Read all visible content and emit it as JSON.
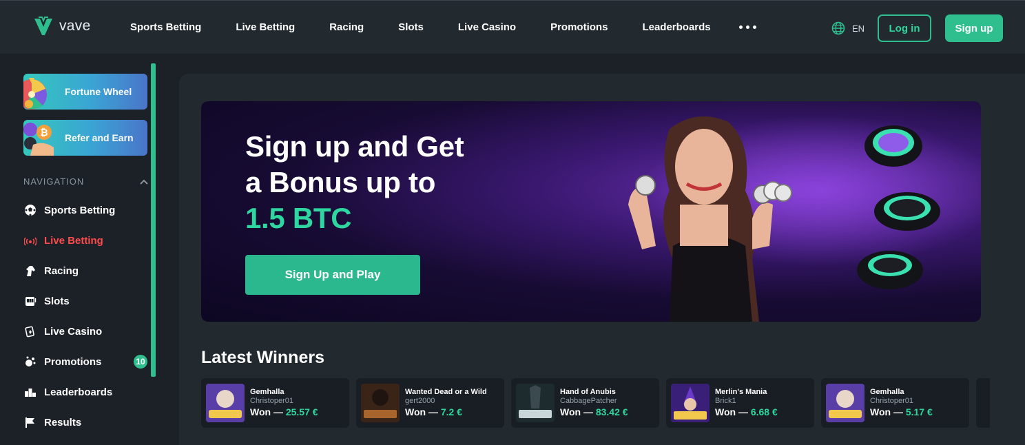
{
  "brand": {
    "name": "vave",
    "accent": "#2fbf8f"
  },
  "topnav": {
    "items": [
      "Sports Betting",
      "Live Betting",
      "Racing",
      "Slots",
      "Live Casino",
      "Promotions",
      "Leaderboards"
    ],
    "language": "EN",
    "login_label": "Log in",
    "signup_label": "Sign up"
  },
  "sidebar": {
    "promos": [
      {
        "label": "Fortune Wheel",
        "icon": "fortune-wheel-icon"
      },
      {
        "label": "Refer and Earn",
        "icon": "bitcoin-coin-icon"
      }
    ],
    "nav_heading": "NAVIGATION",
    "items": [
      {
        "label": "Sports Betting",
        "icon": "soccer-ball-icon"
      },
      {
        "label": "Live Betting",
        "icon": "live-signal-icon"
      },
      {
        "label": "Racing",
        "icon": "horse-head-icon"
      },
      {
        "label": "Slots",
        "icon": "slot-machine-icon"
      },
      {
        "label": "Live Casino",
        "icon": "playing-cards-icon"
      },
      {
        "label": "Promotions",
        "icon": "confetti-icon",
        "badge": "10"
      },
      {
        "label": "Leaderboards",
        "icon": "podium-icon"
      },
      {
        "label": "Results",
        "icon": "flag-icon"
      }
    ]
  },
  "banner": {
    "line1": "Sign up and Get",
    "line2": "a Bonus up to",
    "highlight": "1.5 BTC",
    "cta": "Sign Up and Play"
  },
  "winners": {
    "title": "Latest Winners",
    "won_prefix": "Won — ",
    "items": [
      {
        "game": "Gemhalla",
        "user": "Christoper01",
        "amount": "25.57 €"
      },
      {
        "game": "Wanted Dead or a Wild",
        "user": "gert2000",
        "amount": "7.2 €"
      },
      {
        "game": "Hand of Anubis",
        "user": "CabbagePatcher",
        "amount": "83.42 €"
      },
      {
        "game": "Merlin's Mania",
        "user": "Brick1",
        "amount": "6.68 €"
      },
      {
        "game": "Gemhalla",
        "user": "Christoper01",
        "amount": "5.17 €"
      }
    ]
  }
}
